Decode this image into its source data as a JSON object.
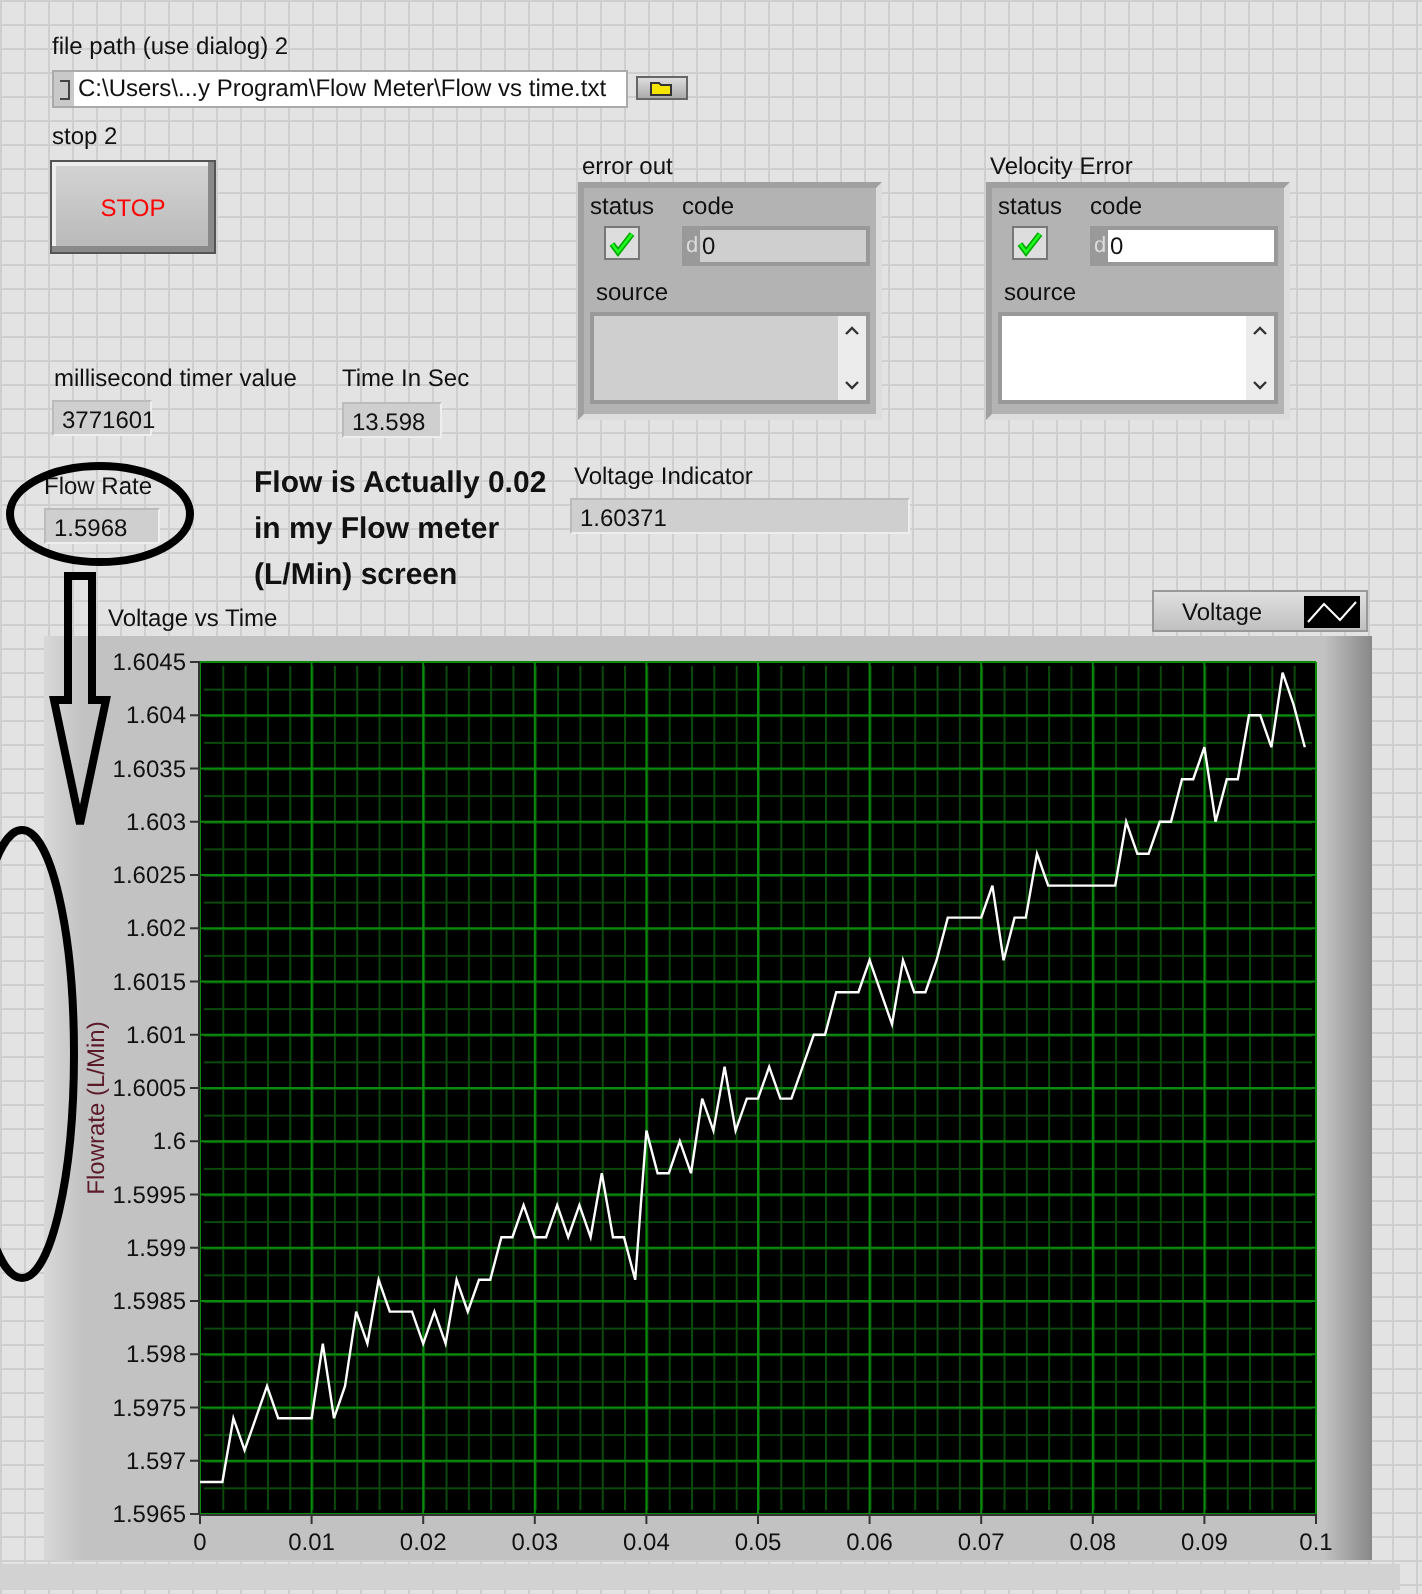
{
  "file_path": {
    "label": "file path (use dialog) 2",
    "value": "C:\\Users\\...y Program\\Flow Meter\\Flow vs time.txt"
  },
  "stop_button": {
    "label": "stop 2",
    "text": "STOP"
  },
  "error_clusters": [
    {
      "label": "error out",
      "kind": "indicator",
      "status_label": "status",
      "status": true,
      "code_label": "code",
      "code_radix": "d",
      "code": "0",
      "source_label": "source"
    },
    {
      "label": "Velocity Error",
      "kind": "control",
      "status_label": "status",
      "status": true,
      "code_label": "code",
      "code_radix": "d",
      "code": "0",
      "source_label": "source"
    }
  ],
  "millisecond_timer": {
    "label": "millisecond timer value",
    "value": "3771601"
  },
  "time_in_sec": {
    "label": "Time In Sec",
    "value": "13.598"
  },
  "flow_rate": {
    "label": "Flow Rate",
    "value": "1.5968"
  },
  "voltage_indicator": {
    "label": "Voltage Indicator",
    "value": "1.60371"
  },
  "annotation": {
    "text": "Flow is Actually 0.02 in my Flow meter (L/Min) screen"
  },
  "chart": {
    "chart_data": {
      "type": "line",
      "grid": true,
      "title": "Voltage vs Time",
      "ylabel": "Flowrate (L/Min)",
      "xlim": [
        0,
        0.1
      ],
      "ylim": [
        1.5965,
        1.6045
      ],
      "xticks": [
        0,
        0.01,
        0.02,
        0.03,
        0.04,
        0.05,
        0.06,
        0.07,
        0.08,
        0.09,
        0.1
      ],
      "yticks": [
        1.5965,
        1.597,
        1.5975,
        1.598,
        1.5985,
        1.599,
        1.5995,
        1.6,
        1.6005,
        1.601,
        1.6015,
        1.602,
        1.6025,
        1.603,
        1.6035,
        1.604,
        1.6045
      ],
      "x": [
        0,
        0.001,
        0.002,
        0.003,
        0.004,
        0.005,
        0.006,
        0.007,
        0.008,
        0.009,
        0.01,
        0.011,
        0.012,
        0.013,
        0.014,
        0.015,
        0.016,
        0.017,
        0.018,
        0.019,
        0.02,
        0.021,
        0.022,
        0.023,
        0.024,
        0.025,
        0.026,
        0.027,
        0.028,
        0.029,
        0.03,
        0.031,
        0.032,
        0.033,
        0.034,
        0.035,
        0.036,
        0.037,
        0.038,
        0.039,
        0.04,
        0.041,
        0.042,
        0.043,
        0.044,
        0.045,
        0.046,
        0.047,
        0.048,
        0.049,
        0.05,
        0.051,
        0.052,
        0.053,
        0.054,
        0.055,
        0.056,
        0.057,
        0.058,
        0.059,
        0.06,
        0.061,
        0.062,
        0.063,
        0.064,
        0.065,
        0.066,
        0.067,
        0.068,
        0.069,
        0.07,
        0.071,
        0.072,
        0.073,
        0.074,
        0.075,
        0.076,
        0.077,
        0.078,
        0.079,
        0.08,
        0.081,
        0.082,
        0.083,
        0.084,
        0.085,
        0.086,
        0.087,
        0.088,
        0.089,
        0.09,
        0.091,
        0.092,
        0.093,
        0.094,
        0.095,
        0.096,
        0.097,
        0.098,
        0.099
      ],
      "series": [
        {
          "name": "Voltage",
          "color": "#ffffff",
          "values": [
            1.5968,
            1.5968,
            1.5968,
            1.5974,
            1.5971,
            1.5974,
            1.5977,
            1.5974,
            1.5974,
            1.5974,
            1.5974,
            1.5981,
            1.5974,
            1.5977,
            1.5984,
            1.5981,
            1.5987,
            1.5984,
            1.5984,
            1.5984,
            1.5981,
            1.5984,
            1.5981,
            1.5987,
            1.5984,
            1.5987,
            1.5987,
            1.5991,
            1.5991,
            1.5994,
            1.5991,
            1.5991,
            1.5994,
            1.5991,
            1.5994,
            1.5991,
            1.5997,
            1.5991,
            1.5991,
            1.5987,
            1.6001,
            1.5997,
            1.5997,
            1.6,
            1.5997,
            1.6004,
            1.6001,
            1.6007,
            1.6001,
            1.6004,
            1.6004,
            1.6007,
            1.6004,
            1.6004,
            1.6007,
            1.601,
            1.601,
            1.6014,
            1.6014,
            1.6014,
            1.6017,
            1.6014,
            1.6011,
            1.6017,
            1.6014,
            1.6014,
            1.6017,
            1.6021,
            1.6021,
            1.6021,
            1.6021,
            1.6024,
            1.6017,
            1.6021,
            1.6021,
            1.6027,
            1.6024,
            1.6024,
            1.6024,
            1.6024,
            1.6024,
            1.6024,
            1.6024,
            1.603,
            1.6027,
            1.6027,
            1.603,
            1.603,
            1.6034,
            1.6034,
            1.6037,
            1.603,
            1.6034,
            1.6034,
            1.604,
            1.604,
            1.6037,
            1.6044,
            1.6041,
            1.6037
          ]
        }
      ]
    }
  }
}
